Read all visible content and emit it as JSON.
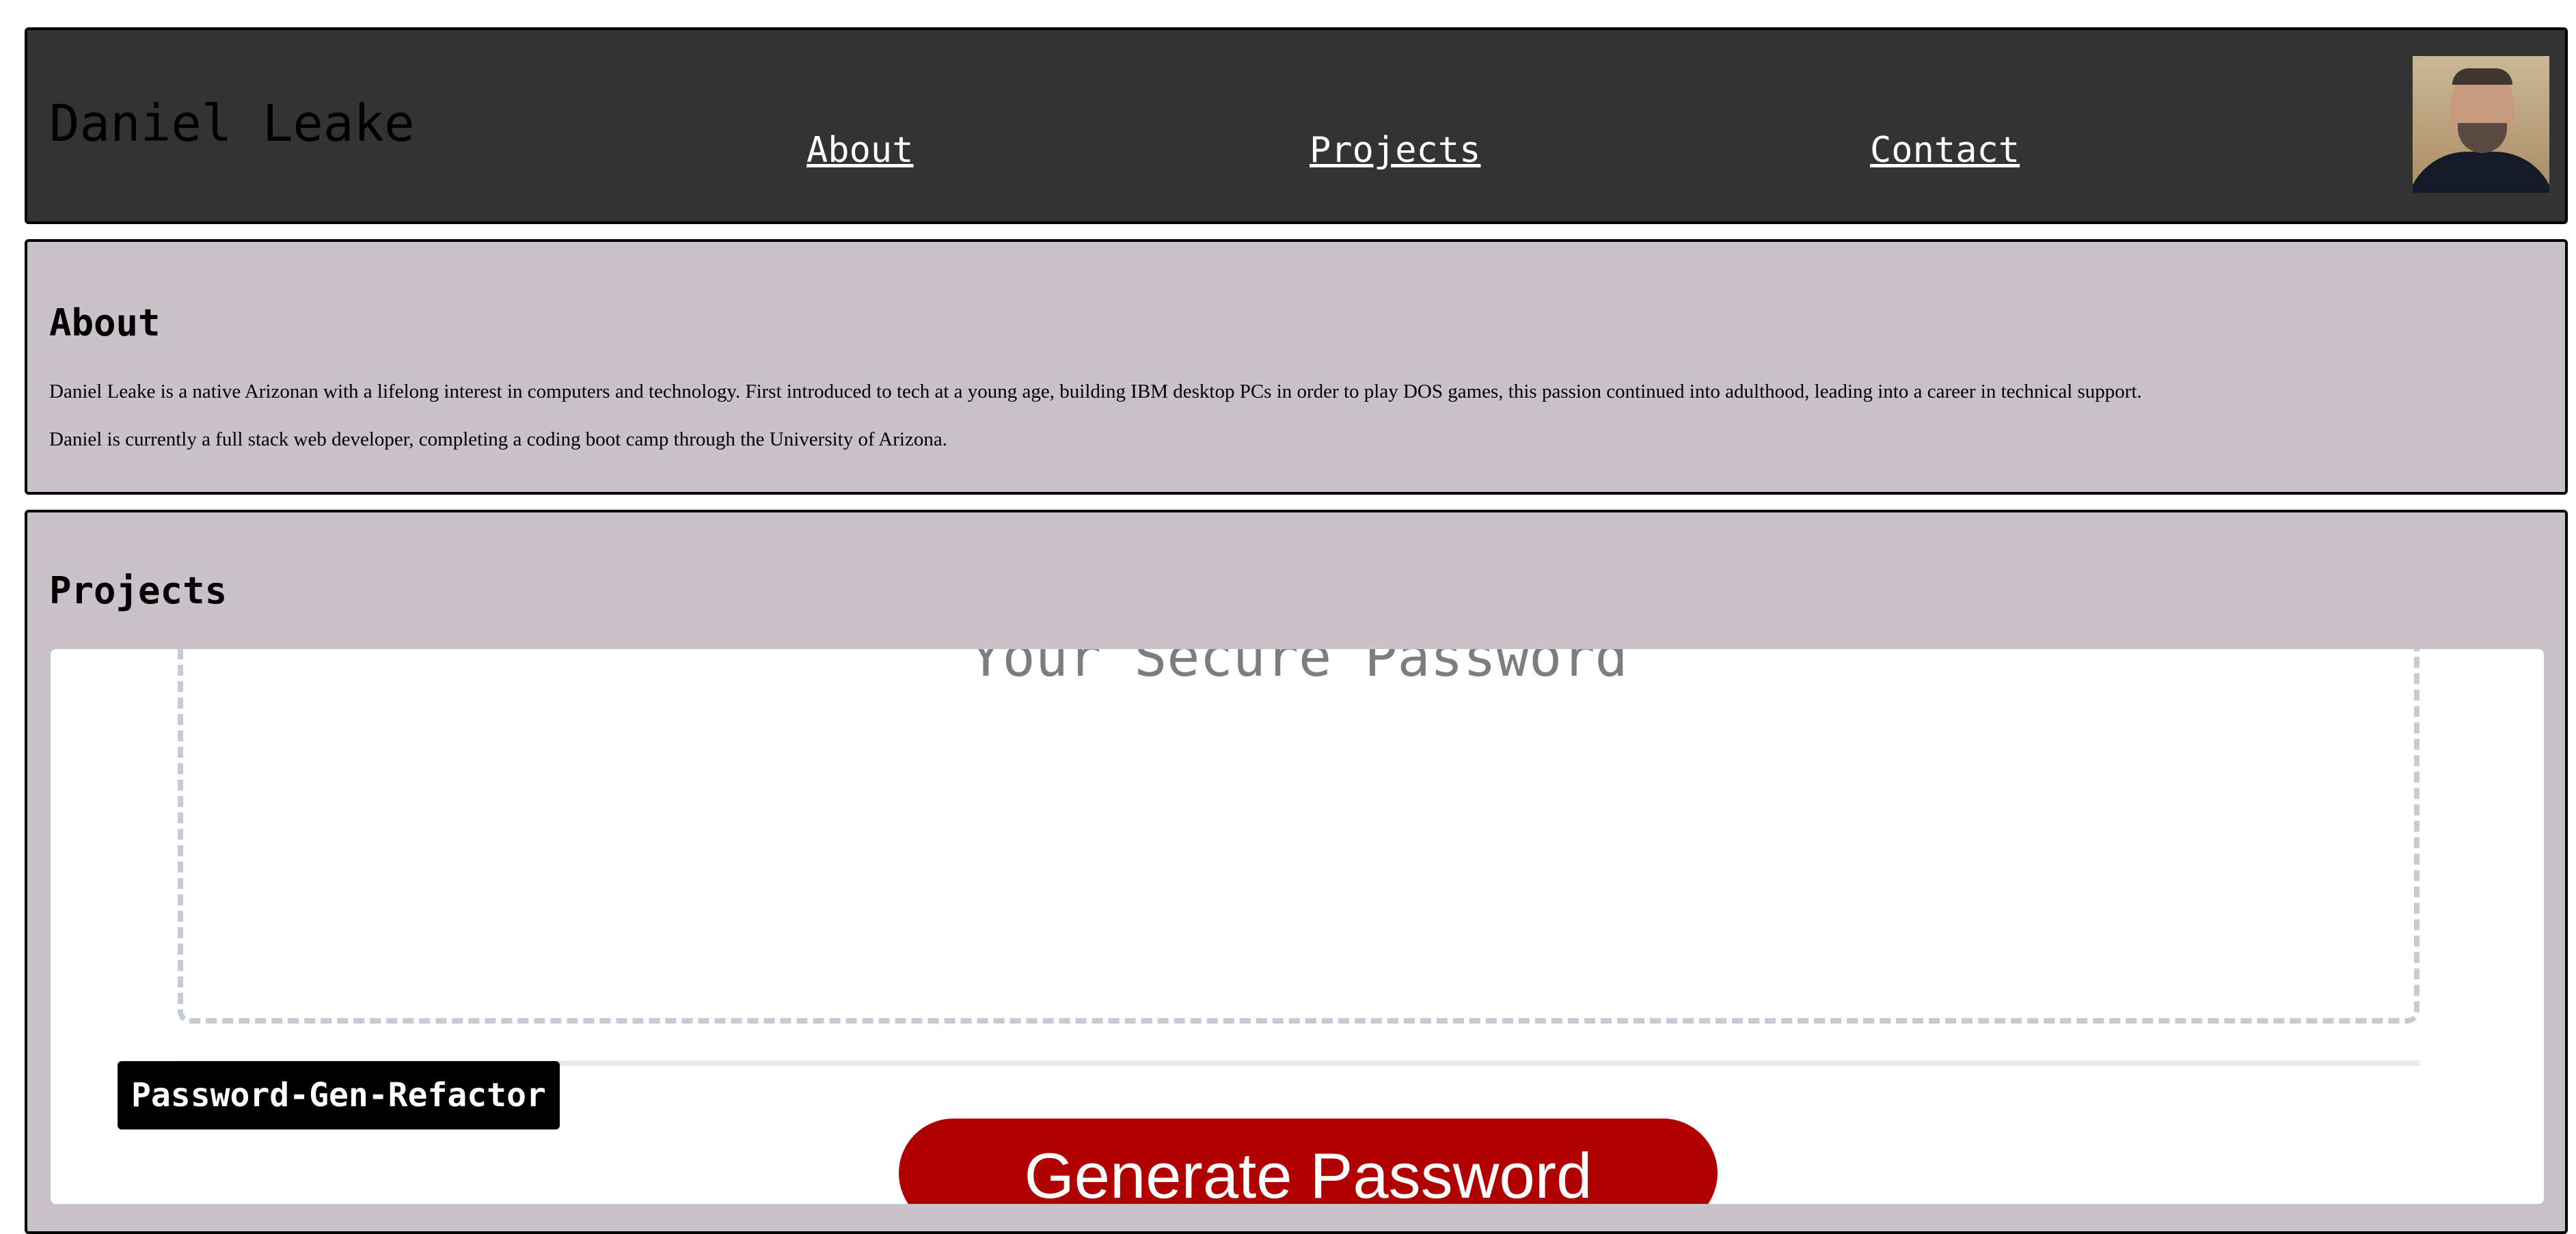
{
  "header": {
    "title": "Daniel Leake",
    "nav": {
      "about": "About",
      "projects": "Projects",
      "contact": "Contact"
    },
    "avatar_alt": "Photo of Daniel Leake"
  },
  "about": {
    "heading": "About",
    "paragraphs": [
      "Daniel Leake is a native Arizonan with a lifelong interest in computers and technology. First introduced to tech at a young age, building IBM desktop PCs in order to play DOS games, this passion continued into adulthood, leading into a career in technical support.",
      "Daniel is currently a full stack web developer, completing a coding boot camp through the University of Arizona."
    ]
  },
  "projects": {
    "heading": "Projects",
    "items": [
      {
        "label": "Password-Gen-Refactor",
        "preview": {
          "placeholder": "Your Secure Password",
          "button_label": "Generate Password",
          "button_color": "#b10000"
        }
      }
    ]
  },
  "colors": {
    "header_bg": "#333333",
    "section_bg": "#c9c2c9",
    "nav_text": "#ffffff"
  }
}
